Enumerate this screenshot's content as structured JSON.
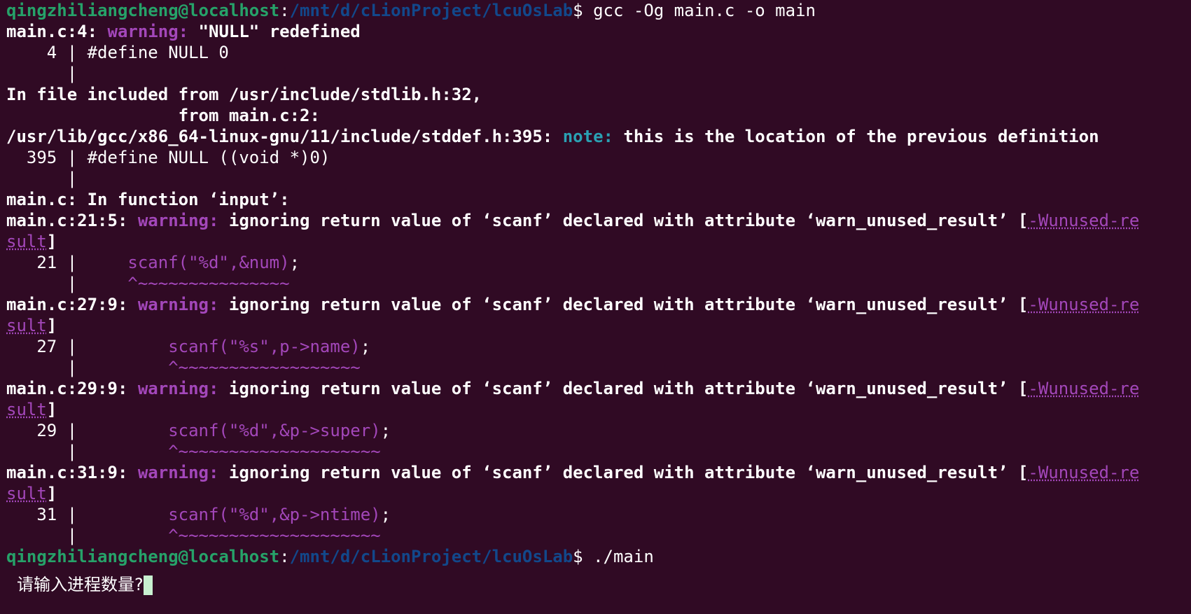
{
  "terminal": {
    "prompt": {
      "user": "qingzhiliangcheng@localhost",
      "sep": ":",
      "path": "/mnt/d/cLionProject/lcuOsLab",
      "dollar": "$ "
    },
    "cmd1": "gcc -Og main.c -o main",
    "redef": {
      "loc": "main.c:4: ",
      "kw": "warning:",
      "msg": " \"NULL\" redefined",
      "src_line": "    4 | #define NULL 0",
      "bar": "      |"
    },
    "include1": "In file included from /usr/include/stdlib.h:32,",
    "include2": "                 from main.c:2:",
    "note": {
      "loc": "/usr/lib/gcc/x86_64-linux-gnu/11/include/stddef.h:395: ",
      "kw": "note:",
      "msg": " this is the location of the previous definition",
      "src_line": "  395 | #define NULL ((void *)0)",
      "bar": "      |"
    },
    "func_line": "main.c: In function ‘input’:",
    "warnings": [
      {
        "loc": "main.c:21:5: ",
        "kw": "warning:",
        "msg": " ignoring return value of ‘scanf’ declared with attribute ‘warn_unused_result’ [",
        "flag1": "-Wunused-re",
        "flag2": "sult",
        "close": "]",
        "num": "   21 | ",
        "pad": "    ",
        "code": "scanf(\"%d\",&num)",
        "semi": ";",
        "bar": "      | ",
        "caret": "    ^~~~~~~~~~~~~~~~"
      },
      {
        "loc": "main.c:27:9: ",
        "kw": "warning:",
        "msg": " ignoring return value of ‘scanf’ declared with attribute ‘warn_unused_result’ [",
        "flag1": "-Wunused-re",
        "flag2": "sult",
        "close": "]",
        "num": "   27 | ",
        "pad": "        ",
        "code": "scanf(\"%s\",p->name)",
        "semi": ";",
        "bar": "      | ",
        "caret": "        ^~~~~~~~~~~~~~~~~~~"
      },
      {
        "loc": "main.c:29:9: ",
        "kw": "warning:",
        "msg": " ignoring return value of ‘scanf’ declared with attribute ‘warn_unused_result’ [",
        "flag1": "-Wunused-re",
        "flag2": "sult",
        "close": "]",
        "num": "   29 | ",
        "pad": "        ",
        "code": "scanf(\"%d\",&p->super)",
        "semi": ";",
        "bar": "      | ",
        "caret": "        ^~~~~~~~~~~~~~~~~~~~~"
      },
      {
        "loc": "main.c:31:9: ",
        "kw": "warning:",
        "msg": " ignoring return value of ‘scanf’ declared with attribute ‘warn_unused_result’ [",
        "flag1": "-Wunused-re",
        "flag2": "sult",
        "close": "]",
        "num": "   31 | ",
        "pad": "        ",
        "code": "scanf(\"%d\",&p->ntime)",
        "semi": ";",
        "bar": "      | ",
        "caret": "        ^~~~~~~~~~~~~~~~~~~~~"
      }
    ],
    "cmd2": "./main",
    "input_prompt": "请输入进程数量?"
  },
  "colors": {
    "background": "#300a24",
    "prompt_user": "#26a269",
    "prompt_path": "#12488b",
    "warning": "#a347ba",
    "note": "#2aa1b3",
    "cursor": "#c8f0d0"
  }
}
